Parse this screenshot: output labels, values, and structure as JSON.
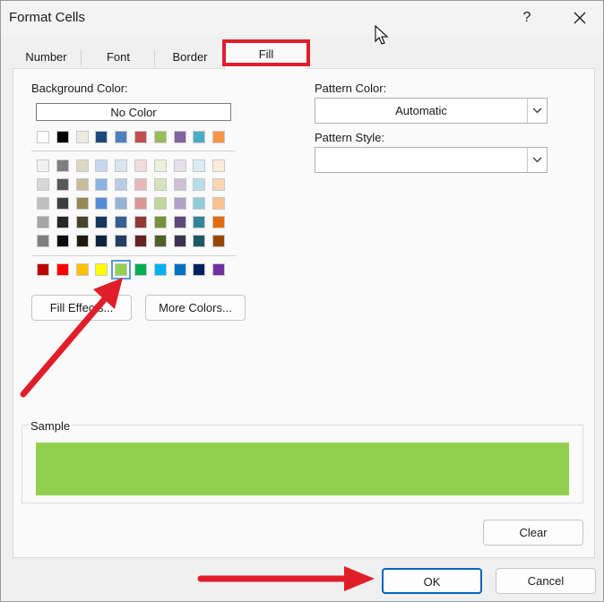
{
  "window": {
    "title": "Format Cells",
    "help": "?"
  },
  "tabs": [
    {
      "label": "Number"
    },
    {
      "label": "Font"
    },
    {
      "label": "Border"
    },
    {
      "label": "Fill",
      "active": true
    }
  ],
  "fill": {
    "background_color_label": "Background Color:",
    "no_color_label": "No Color",
    "theme_top_row": [
      "#ffffff",
      "#000000",
      "#eeece1",
      "#1f497d",
      "#4f81bd",
      "#c0504d",
      "#9bbb59",
      "#8064a2",
      "#4bacc6",
      "#f79646"
    ],
    "theme_grid": [
      [
        "#f2f2f2",
        "#7f7f7f",
        "#ddd9c3",
        "#c6d9f0",
        "#dbe5f1",
        "#f2dcdb",
        "#ebf1dd",
        "#e5e0ec",
        "#dbeef3",
        "#fdeada"
      ],
      [
        "#d8d8d8",
        "#595959",
        "#c4bd97",
        "#8db3e2",
        "#b8cce4",
        "#e5b9b7",
        "#d7e3bc",
        "#ccc1d9",
        "#b7dde8",
        "#fbd5b5"
      ],
      [
        "#bfbfbf",
        "#3f3f3f",
        "#938953",
        "#548dd4",
        "#95b3d7",
        "#d99694",
        "#c3d69b",
        "#b2a2c7",
        "#92cddc",
        "#fac08f"
      ],
      [
        "#a5a5a5",
        "#262626",
        "#494429",
        "#17365d",
        "#366092",
        "#953734",
        "#76923c",
        "#5f497a",
        "#31859b",
        "#e36c09"
      ],
      [
        "#7f7f7f",
        "#0c0c0c",
        "#1d1b10",
        "#0f243e",
        "#244061",
        "#632423",
        "#4f6128",
        "#3f3151",
        "#205867",
        "#974806"
      ]
    ],
    "standard_colors": [
      "#c00000",
      "#ff0000",
      "#ffc000",
      "#ffff00",
      "#92d050",
      "#00b050",
      "#00b0f0",
      "#0070c0",
      "#002060",
      "#7030a0"
    ],
    "selected_standard_index": 4,
    "fill_effects_label": "Fill Effects...",
    "more_colors_label": "More Colors...",
    "pattern_color_label": "Pattern Color:",
    "pattern_color_value": "Automatic",
    "pattern_style_label": "Pattern Style:",
    "pattern_style_value": "",
    "sample_label": "Sample",
    "sample_color": "#92d050",
    "clear_label": "Clear"
  },
  "footer": {
    "ok_label": "OK",
    "cancel_label": "Cancel"
  },
  "colors": {
    "annotation_red": "#e01e2a",
    "focus_blue": "#0067c0"
  }
}
